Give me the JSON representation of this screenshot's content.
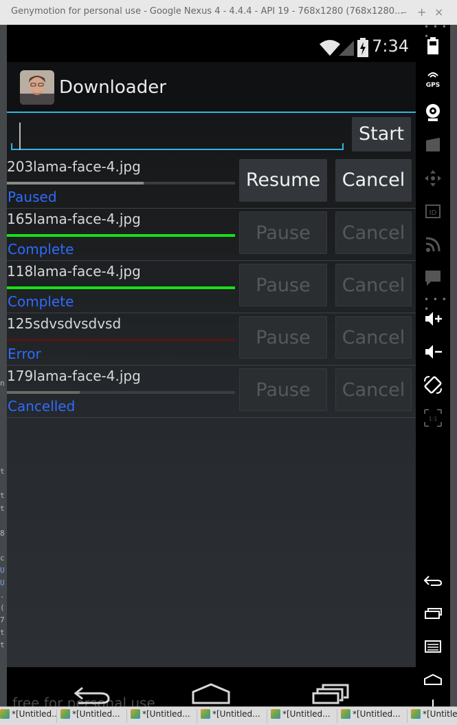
{
  "window": {
    "title": "Genymotion for personal use - Google Nexus 4 - 4.4.4 - API 19 - 768x1280 (768x1280...",
    "controls": [
      "–",
      "+",
      "×"
    ]
  },
  "status_bar": {
    "time": "7:34"
  },
  "action_bar": {
    "app_title": "Downloader"
  },
  "url_input": {
    "value": "",
    "placeholder": ""
  },
  "start_button": "Start",
  "downloads": [
    {
      "filename": "203lama-face-4.jpg",
      "status": "Paused",
      "progress": 0.6,
      "bar_color": "#8a8a8a",
      "primary_label": "Resume",
      "cancel_label": "Cancel",
      "enabled": true
    },
    {
      "filename": "165lama-face-4.jpg",
      "status": "Complete",
      "progress": 1.0,
      "bar_color": "#16e016",
      "primary_label": "Pause",
      "cancel_label": "Cancel",
      "enabled": false
    },
    {
      "filename": "118lama-face-4.jpg",
      "status": "Complete",
      "progress": 1.0,
      "bar_color": "#16e016",
      "primary_label": "Pause",
      "cancel_label": "Cancel",
      "enabled": false
    },
    {
      "filename": "125sdvsdvsdvsd",
      "status": "Error",
      "progress": 1.0,
      "bar_color": "#4a1a1a",
      "primary_label": "Pause",
      "cancel_label": "Cancel",
      "enabled": false
    },
    {
      "filename": "179lama-face-4.jpg",
      "status": "Cancelled",
      "progress": 0.32,
      "bar_color": "#6a6a6a",
      "primary_label": "Pause",
      "cancel_label": "Cancel",
      "enabled": false
    }
  ],
  "nav_watermark": "free for personal use",
  "sidebar": {
    "gps_label": "GPS",
    "id_label": "ID",
    "ratio_label": "1:1"
  },
  "left_edge_glyphs": [
    "n",
    "t",
    "t",
    "t",
    "8",
    "c",
    "U",
    "U",
    ".",
    "(",
    "7",
    "t",
    "t"
  ],
  "taskbar": {
    "items": [
      "*[Untitled...",
      "*[Untitled...",
      "*[Untitled...",
      "*[Untitled...",
      "*[Untitled...",
      "*[Untitled...",
      "*[Untitle"
    ]
  }
}
